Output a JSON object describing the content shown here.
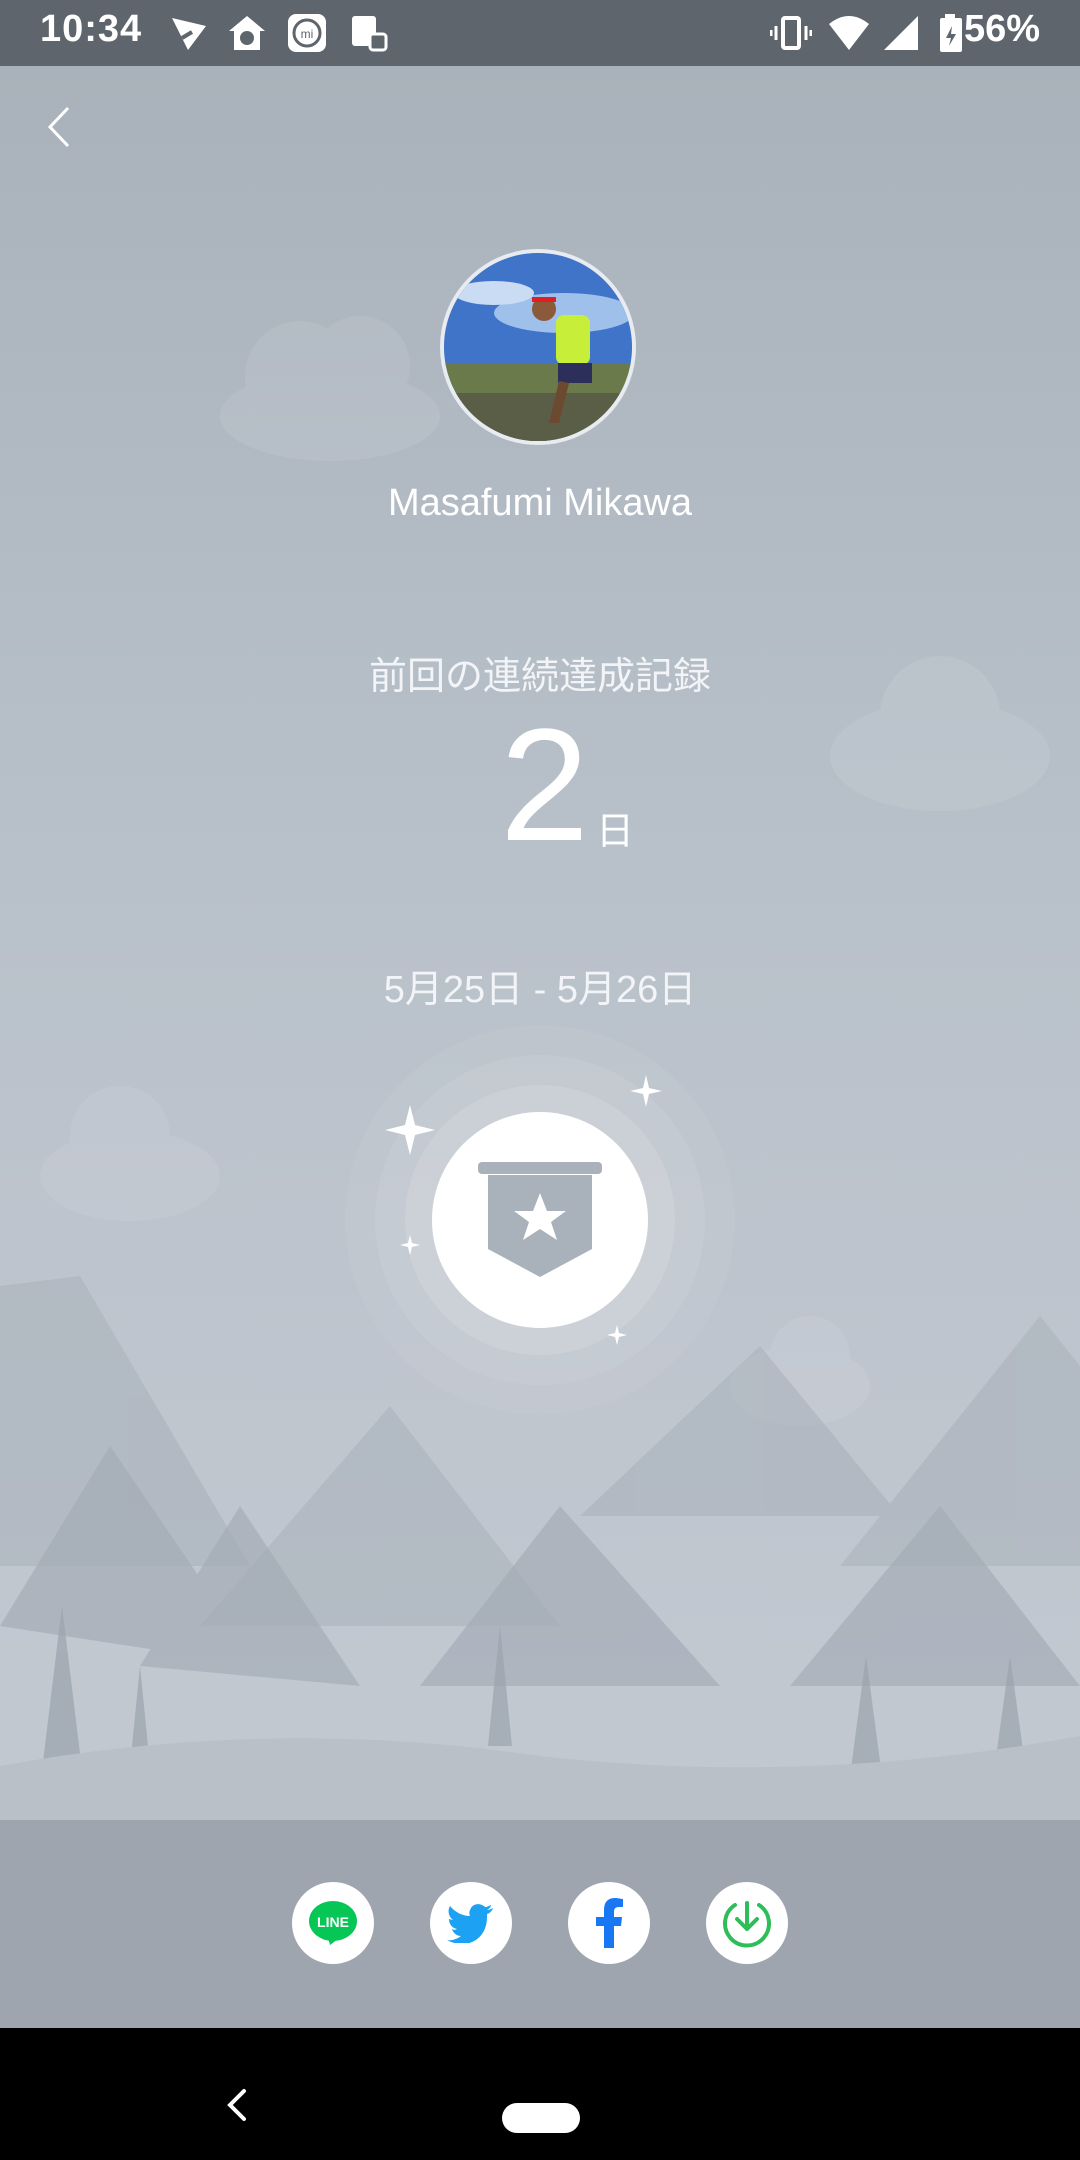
{
  "status_bar": {
    "time": "10:34",
    "battery": "56%"
  },
  "profile": {
    "name": "Masafumi Mikawa"
  },
  "record": {
    "label": "前回の連続達成記録",
    "value": "2",
    "unit": "日",
    "date_range": "5月25日 - 5月26日"
  },
  "share": {
    "line_label": "LINE"
  },
  "colors": {
    "line_green": "#06c755",
    "twitter_blue": "#1da1f2",
    "facebook_blue": "#1877f2",
    "download_green": "#2ebd59"
  }
}
